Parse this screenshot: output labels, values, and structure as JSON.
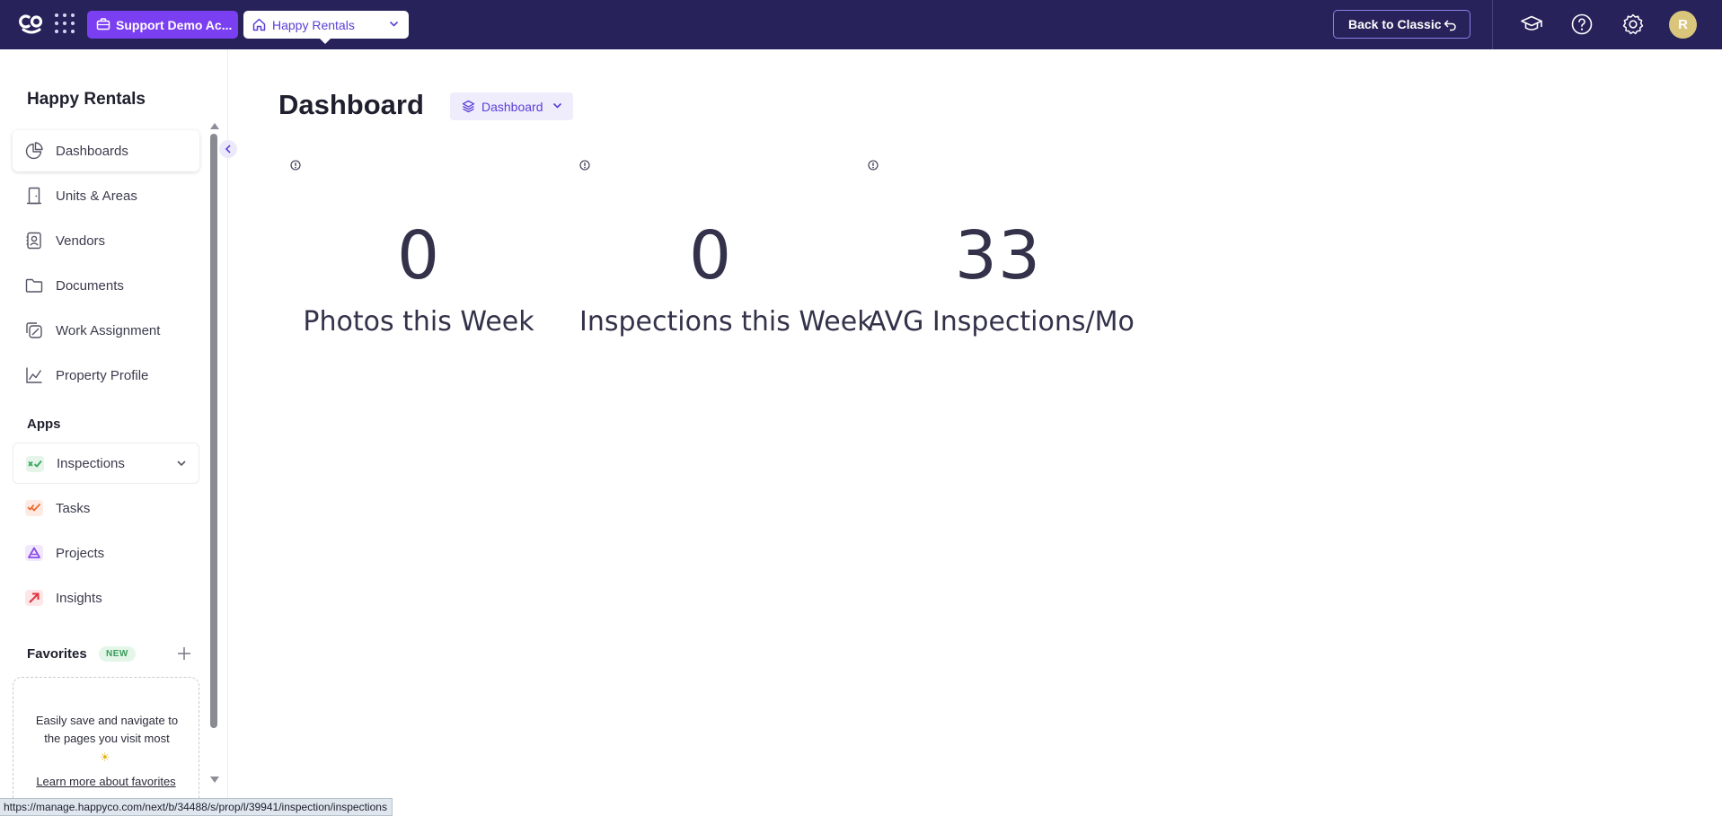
{
  "topbar": {
    "account_label": "Support Demo Ac...",
    "property_label": "Happy Rentals",
    "back_classic_label": "Back to Classic",
    "avatar_initial": "R"
  },
  "sidebar": {
    "title": "Happy Rentals",
    "nav_items": [
      {
        "label": "Dashboards",
        "icon": "pie-chart-icon"
      },
      {
        "label": "Units & Areas",
        "icon": "door-icon"
      },
      {
        "label": "Vendors",
        "icon": "contact-card-icon"
      },
      {
        "label": "Documents",
        "icon": "folder-icon"
      },
      {
        "label": "Work Assignment",
        "icon": "assignment-icon"
      },
      {
        "label": "Property Profile",
        "icon": "line-chart-icon"
      }
    ],
    "apps_label": "Apps",
    "apps": [
      {
        "label": "Inspections",
        "icon": "inspections-app-icon",
        "color": "#3aa85a"
      },
      {
        "label": "Tasks",
        "icon": "tasks-app-icon",
        "color": "#f0692f"
      },
      {
        "label": "Projects",
        "icon": "projects-app-icon",
        "color": "#8a4be8"
      },
      {
        "label": "Insights",
        "icon": "insights-app-icon",
        "color": "#e0343f"
      }
    ],
    "favorites_label": "Favorites",
    "favorites_badge": "NEW",
    "favorites_empty_text": "Easily save and navigate to the pages you visit most",
    "favorites_sun": "☀",
    "favorites_link": "Learn more about favorites"
  },
  "main": {
    "page_title": "Dashboard",
    "dashboard_select_label": "Dashboard",
    "stats": [
      {
        "value": "0",
        "label": "Photos this Week"
      },
      {
        "value": "0",
        "label": "Inspections this Week"
      },
      {
        "value": "33",
        "label": "AVG Inspections/Mo"
      }
    ]
  },
  "status_bar": {
    "url": "https://manage.happyco.com/next/b/34488/s/prop/l/39941/inspection/inspections"
  },
  "colors": {
    "topbar_bg": "#27235a",
    "accent_purple": "#7b3ff2",
    "link_purple": "#5b3fd6"
  }
}
